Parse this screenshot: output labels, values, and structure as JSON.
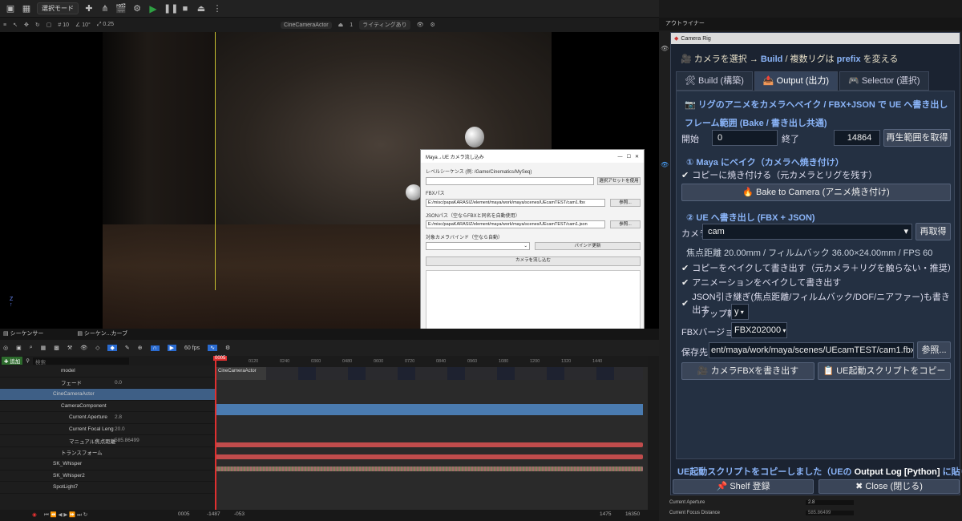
{
  "toolbar": {
    "mode_label": "選択モード"
  },
  "viewport_toolbar": {
    "angle": "10°",
    "scale": "0.25",
    "camera_actor": "CineCameraActor",
    "camera_count": "1",
    "lighting": "ライティングあり",
    "grid": "10"
  },
  "maya_dialog": {
    "title": "Maya→UE カメラ流し込み",
    "level_seq_label": "レベルシーケンス (例: /Game/Cinematics/MySeq)",
    "level_seq_value": "",
    "use_selected_btn": "選択アセットを使用",
    "fbx_label": "FBXパス",
    "fbx_value": "E:/misc/papaKARASIZ/element/maya/work/maya/scenes/UEcamTEST/cam1.fbx",
    "browse1": "参照...",
    "json_label": "JSONパス（空ならFBXと同名を自動使用）",
    "json_value": "E:/misc/papaKARASIZ/element/maya/work/maya/scenes/UEcamTEST/cam1.json",
    "browse2": "参照...",
    "bind_label": "対象カメラバインド（空なら自動）",
    "bind_update_btn": "バインド更新",
    "import_btn": "カメラを流し込む"
  },
  "outliner": {
    "tab_label": "アウトライナー"
  },
  "rig": {
    "window_title": "Camera Rig",
    "header_pre": "カメラを選択 → ",
    "header_build": "Build",
    "header_mid": " / 複数リグは ",
    "header_prefix": "prefix",
    "header_post": " を変える",
    "tabs": [
      {
        "icon": "🛠",
        "label": "Build (構築)"
      },
      {
        "icon": "📤",
        "label": "Output (出力)"
      },
      {
        "icon": "🎮",
        "label": "Selector (選択)"
      }
    ],
    "output_title": "リグのアニメをカメラへベイク / FBX+JSON で UE へ書き出し",
    "frame_range_title": "フレーム範囲 (Bake / 書き出し共通)",
    "start_label": "開始",
    "start_value": "0",
    "end_label": "終了",
    "end_value": "14864",
    "get_range_btn": "再生範囲を取得",
    "bake_section": "① Maya にベイク（カメラへ焼き付け）",
    "bake_copy_check": "コピーに焼き付ける（元カメラとリグを残す）",
    "bake_btn": "Bake to Camera (アニメ焼き付け)",
    "ue_section": "② UE へ書き出し (FBX + JSON)",
    "camera_label": "カメラ",
    "camera_value": "cam",
    "reload_btn": "再取得",
    "cam_info": "焦点距離 20.00mm / フィルムバック 36.00×24.00mm / FPS 60",
    "chk1": "コピーをベイクして書き出す（元カメラ＋リグを触らない・推奨）",
    "chk2": "アニメーションをベイクして書き出す",
    "chk3": "JSON引き継ぎ(焦点距離/フィルムバック/DOF/ニアファー)も書き出す",
    "up_axis_label": "アップ軸",
    "up_axis_value": "y",
    "fbx_ver_label": "FBXバージョン",
    "fbx_ver_value": "FBX202000",
    "save_label": "保存先",
    "save_value": "ent/maya/work/maya/scenes/UEcamTEST/cam1.fbx",
    "browse_btn": "参照...",
    "export_btn": "カメラFBXを書き出す",
    "copy_script_btn": "UE起動スクリプトをコピー",
    "status_pre": "UE起動スクリプトをコピーしました（UEの ",
    "status_log": "Output Log [Python]",
    "status_post": " に貼り付け）",
    "shelf_btn": "Shelf 登録",
    "close_btn": "Close (閉じる)"
  },
  "details": [
    {
      "label": "Current Aperture",
      "value": "2.8"
    },
    {
      "label": "Current Focus Distance",
      "value": "585.86499"
    }
  ],
  "sequencer": {
    "tab1": "シーケンサー",
    "tab2": "シーケン...カーブ",
    "add_label": "追加",
    "search_placeholder": "検索",
    "fps": "60 fps",
    "playhead": "0005",
    "clip_label": "CineCameraActor",
    "ruler": [
      "0120",
      "0240",
      "0360",
      "0480",
      "0600",
      "0720",
      "0840",
      "0960",
      "1080",
      "1200",
      "1320",
      "1440"
    ],
    "tracks": [
      {
        "name": "model",
        "indent": 1,
        "type": "folder",
        "value": ""
      },
      {
        "name": "フェード",
        "indent": 1,
        "type": "track",
        "value": "0.0"
      },
      {
        "name": "CineCameraActor",
        "indent": 0,
        "type": "actor",
        "value": ""
      },
      {
        "name": "CameraComponent",
        "indent": 1,
        "type": "comp",
        "value": ""
      },
      {
        "name": "Current Aperture",
        "indent": 2,
        "type": "prop",
        "value": "2.8"
      },
      {
        "name": "Current Focal Leng",
        "indent": 2,
        "type": "prop",
        "value": "20.0"
      },
      {
        "name": "マニュアル焦点距離",
        "indent": 2,
        "type": "prop",
        "value": "585.86499"
      },
      {
        "name": "トランスフォーム",
        "indent": 1,
        "type": "track",
        "value": ""
      },
      {
        "name": "SK_Whisper",
        "indent": 0,
        "type": "actor",
        "value": ""
      },
      {
        "name": "SK_Whisper2",
        "indent": 0,
        "type": "actor",
        "value": ""
      },
      {
        "name": "SpotLight7",
        "indent": 0,
        "type": "actor",
        "value": ""
      }
    ],
    "frame_current": "0005",
    "range_left": "-1487",
    "range_left2": "-053",
    "range_right": "1475",
    "range_right2": "16350"
  }
}
